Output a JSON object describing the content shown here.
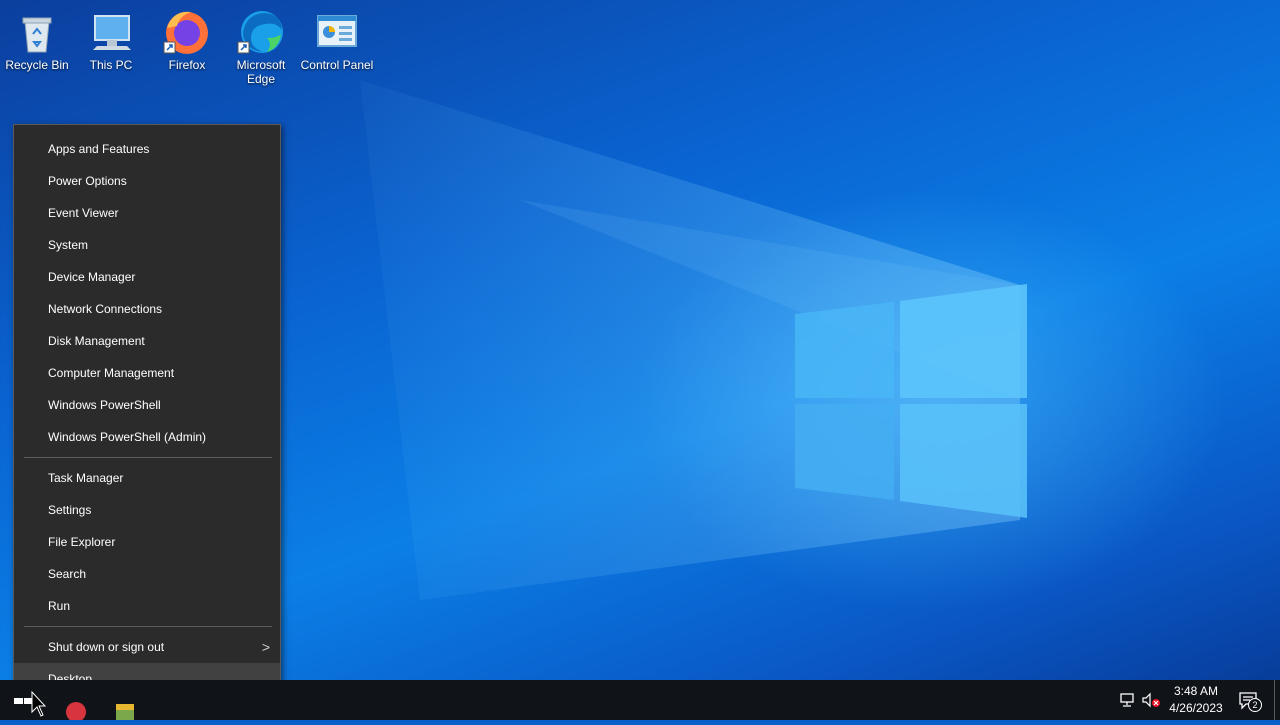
{
  "desktop_icons": [
    {
      "label": "Recycle Bin",
      "icon": "recycle-bin-icon"
    },
    {
      "label": "This PC",
      "icon": "this-pc-icon"
    },
    {
      "label": "Firefox",
      "icon": "firefox-icon"
    },
    {
      "label": "Microsoft Edge",
      "icon": "edge-icon"
    },
    {
      "label": "Control Panel",
      "icon": "control-panel-icon"
    }
  ],
  "context_menu": {
    "items_group1": [
      "Apps and Features",
      "Power Options",
      "Event Viewer",
      "System",
      "Device Manager",
      "Network Connections",
      "Disk Management",
      "Computer Management",
      "Windows PowerShell",
      "Windows PowerShell (Admin)"
    ],
    "items_group2": [
      "Task Manager",
      "Settings",
      "File Explorer",
      "Search",
      "Run"
    ],
    "shutdown_label": "Shut down or sign out",
    "shutdown_chevron": ">",
    "desktop_label": "Desktop"
  },
  "taskbar": {
    "time": "3:48 AM",
    "date": "4/26/2023",
    "notification_count": "2"
  },
  "colors": {
    "menu_bg": "#2b2b2b",
    "menu_hover": "#414141",
    "taskbar_bg": "#101418",
    "wallpaper_blue": "#0a63d0"
  }
}
